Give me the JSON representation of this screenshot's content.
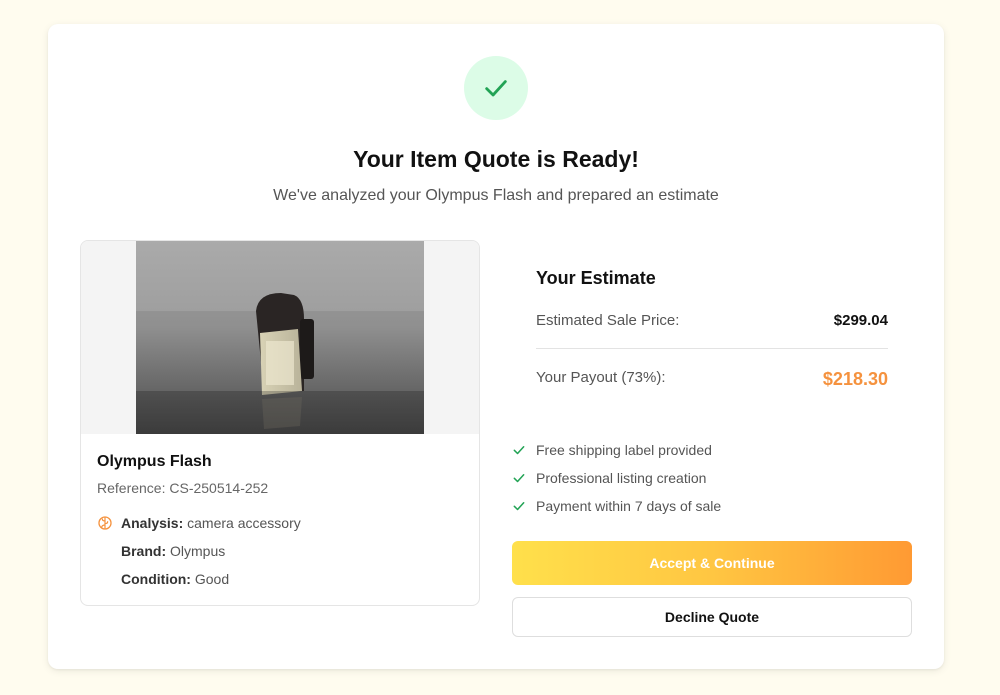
{
  "header": {
    "title": "Your Item Quote is Ready!",
    "subtitle": "We've analyzed your Olympus Flash and prepared an estimate"
  },
  "item": {
    "name": "Olympus Flash",
    "reference": "Reference: CS-250514-252",
    "analysis_label": "Analysis:",
    "analysis_value": "camera accessory",
    "brand_label": "Brand:",
    "brand_value": "Olympus",
    "condition_label": "Condition:",
    "condition_value": "Good"
  },
  "estimate": {
    "title": "Your Estimate",
    "sale_label": "Estimated Sale Price:",
    "sale_value": "$299.04",
    "payout_label": "Your Payout (73%):",
    "payout_value": "$218.30"
  },
  "benefits": [
    "Free shipping label provided",
    "Professional listing creation",
    "Payment within 7 days of sale"
  ],
  "actions": {
    "accept": "Accept & Continue",
    "decline": "Decline Quote"
  },
  "colors": {
    "success_green": "#22a355",
    "success_bg": "#dcfce7",
    "payout_orange": "#f5923e",
    "accent_gradient_start": "#ffe04b",
    "accent_gradient_end": "#ff9a33",
    "page_bg": "#fffcef"
  },
  "icons": {
    "status": "check-icon",
    "analysis": "brain-icon",
    "benefit": "check-icon"
  }
}
